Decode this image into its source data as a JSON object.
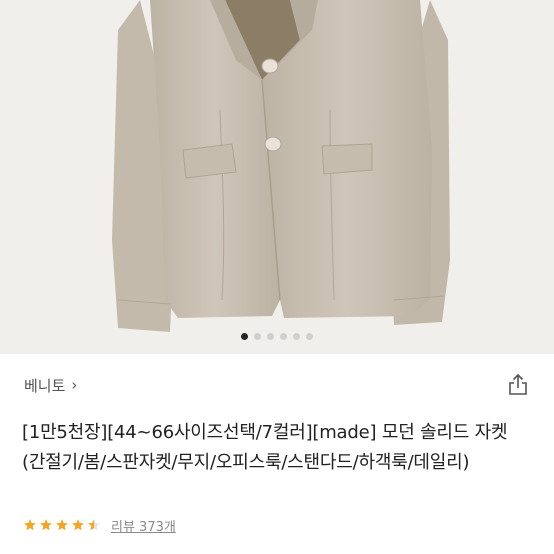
{
  "product": {
    "brand": "베니토",
    "brand_chevron": "›",
    "title": "[1만5천장][44~66사이즈선택/7컬러][made] 모던 솔리드 자켓 (간절기/봄/스판자켓/무지/오피스룩/스탠다드/하객룩/데일리)",
    "rating_value": 4.5,
    "review_label": "리뷰 373개"
  },
  "gallery": {
    "image_subject": "beige-blazer",
    "total_images": 6,
    "active_index": 0
  },
  "icons": {
    "share": "share-icon",
    "star": "star-icon"
  },
  "colors": {
    "star": "#f2a623",
    "jacket": "#c9bfb1",
    "background": "#f1efeb",
    "text": "#222222",
    "muted": "#8a8a8a"
  }
}
